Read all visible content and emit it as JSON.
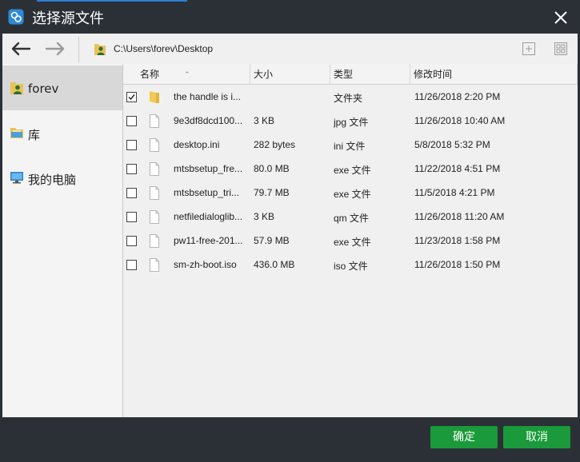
{
  "window": {
    "title": "选择源文件",
    "accent_color": "#2f7fd4",
    "title_bg": "#2b3036"
  },
  "toolbar": {
    "back_icon": "arrow-left-icon",
    "forward_icon": "arrow-right-icon",
    "path": "C:\\Users\\forev\\Desktop",
    "new_folder_icon": "plus-box-icon",
    "view_icon": "grid-view-icon"
  },
  "sidebar": {
    "items": [
      {
        "label": "forev",
        "icon": "user-folder-icon",
        "active": true
      },
      {
        "label": "库",
        "icon": "library-icon",
        "active": false
      },
      {
        "label": "我的电脑",
        "icon": "computer-icon",
        "active": false
      }
    ]
  },
  "table": {
    "columns": {
      "name": "名称",
      "size": "大小",
      "type": "类型",
      "date": "修改时间"
    },
    "rows": [
      {
        "checked": true,
        "icon": "folder-icon",
        "name": "the handle is i...",
        "size": "",
        "type": "文件夹",
        "date": "11/26/2018 2:20 PM"
      },
      {
        "checked": false,
        "icon": "file-icon",
        "name": "9e3df8dcd100...",
        "size": "3 KB",
        "type": "jpg 文件",
        "date": "11/26/2018 10:40 AM"
      },
      {
        "checked": false,
        "icon": "file-icon",
        "name": "desktop.ini",
        "size": "282 bytes",
        "type": "ini 文件",
        "date": "5/8/2018 5:32 PM"
      },
      {
        "checked": false,
        "icon": "file-icon",
        "name": "mtsbsetup_fre...",
        "size": "80.0 MB",
        "type": "exe 文件",
        "date": "11/22/2018 4:51 PM"
      },
      {
        "checked": false,
        "icon": "file-icon",
        "name": "mtsbsetup_tri...",
        "size": "79.7 MB",
        "type": "exe 文件",
        "date": "11/5/2018 4:21 PM"
      },
      {
        "checked": false,
        "icon": "file-icon",
        "name": "netfiledialoglib...",
        "size": "3 KB",
        "type": "qm 文件",
        "date": "11/26/2018 11:20 AM"
      },
      {
        "checked": false,
        "icon": "file-icon",
        "name": "pw11-free-201...",
        "size": "57.9 MB",
        "type": "exe 文件",
        "date": "11/23/2018 1:58 PM"
      },
      {
        "checked": false,
        "icon": "file-icon",
        "name": "sm-zh-boot.iso",
        "size": "436.0 MB",
        "type": "iso 文件",
        "date": "11/26/2018 1:50 PM"
      }
    ]
  },
  "buttons": {
    "ok": "确定",
    "cancel": "取消",
    "color": "#1a9a3a"
  }
}
